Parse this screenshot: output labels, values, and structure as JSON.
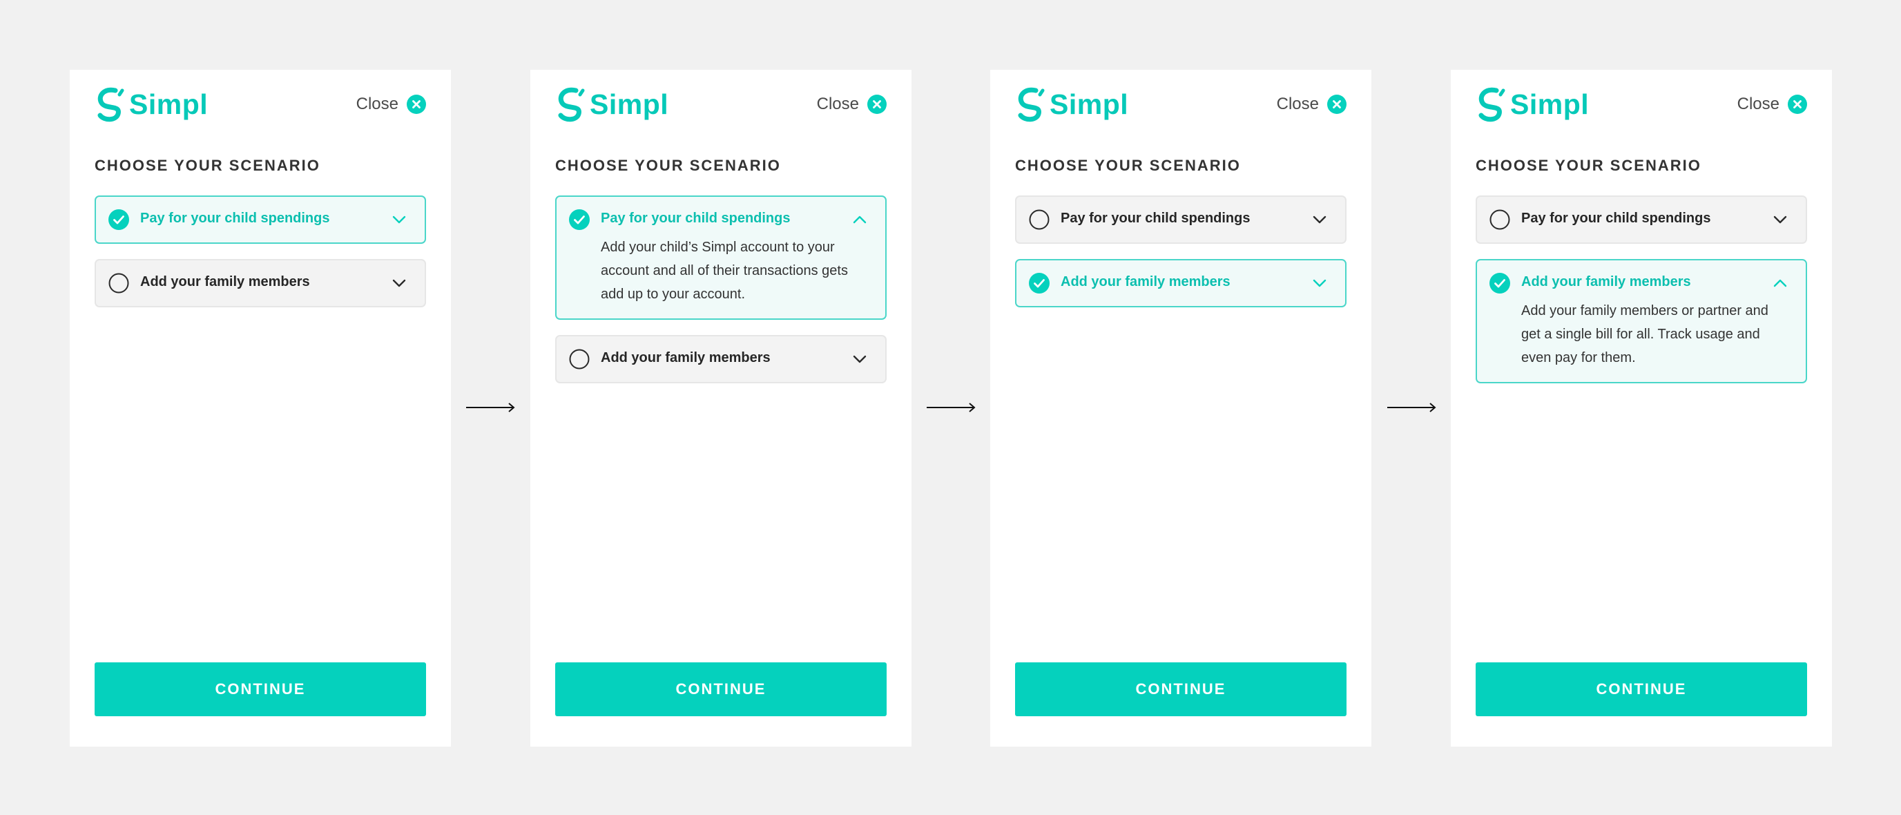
{
  "brand": {
    "name": "Simpl",
    "color": "#06c9b8",
    "logo_icon": "simpl-logo-icon"
  },
  "close_label": "Close",
  "heading": "CHOOSE YOUR SCENARIO",
  "continue_label": "CONTINUE",
  "accent": "#05d1bd",
  "screens": [
    {
      "options": [
        {
          "title": "Pay for your child spendings",
          "selected": true,
          "expanded": false,
          "description": ""
        },
        {
          "title": "Add your family members",
          "selected": false,
          "expanded": false,
          "description": ""
        }
      ]
    },
    {
      "options": [
        {
          "title": "Pay for your child spendings",
          "selected": true,
          "expanded": true,
          "description": "Add your child’s Simpl account to your account and all of their transactions gets add up to your account."
        },
        {
          "title": "Add your family members",
          "selected": false,
          "expanded": false,
          "description": ""
        }
      ]
    },
    {
      "options": [
        {
          "title": "Pay for your child spendings",
          "selected": false,
          "expanded": false,
          "description": ""
        },
        {
          "title": "Add your family members",
          "selected": true,
          "expanded": false,
          "description": ""
        }
      ]
    },
    {
      "options": [
        {
          "title": "Pay for your child spendings",
          "selected": false,
          "expanded": false,
          "description": ""
        },
        {
          "title": "Add your family members",
          "selected": true,
          "expanded": true,
          "description": "Add your family members or partner and get a single bill for all. Track usage and even pay for them."
        }
      ]
    }
  ]
}
